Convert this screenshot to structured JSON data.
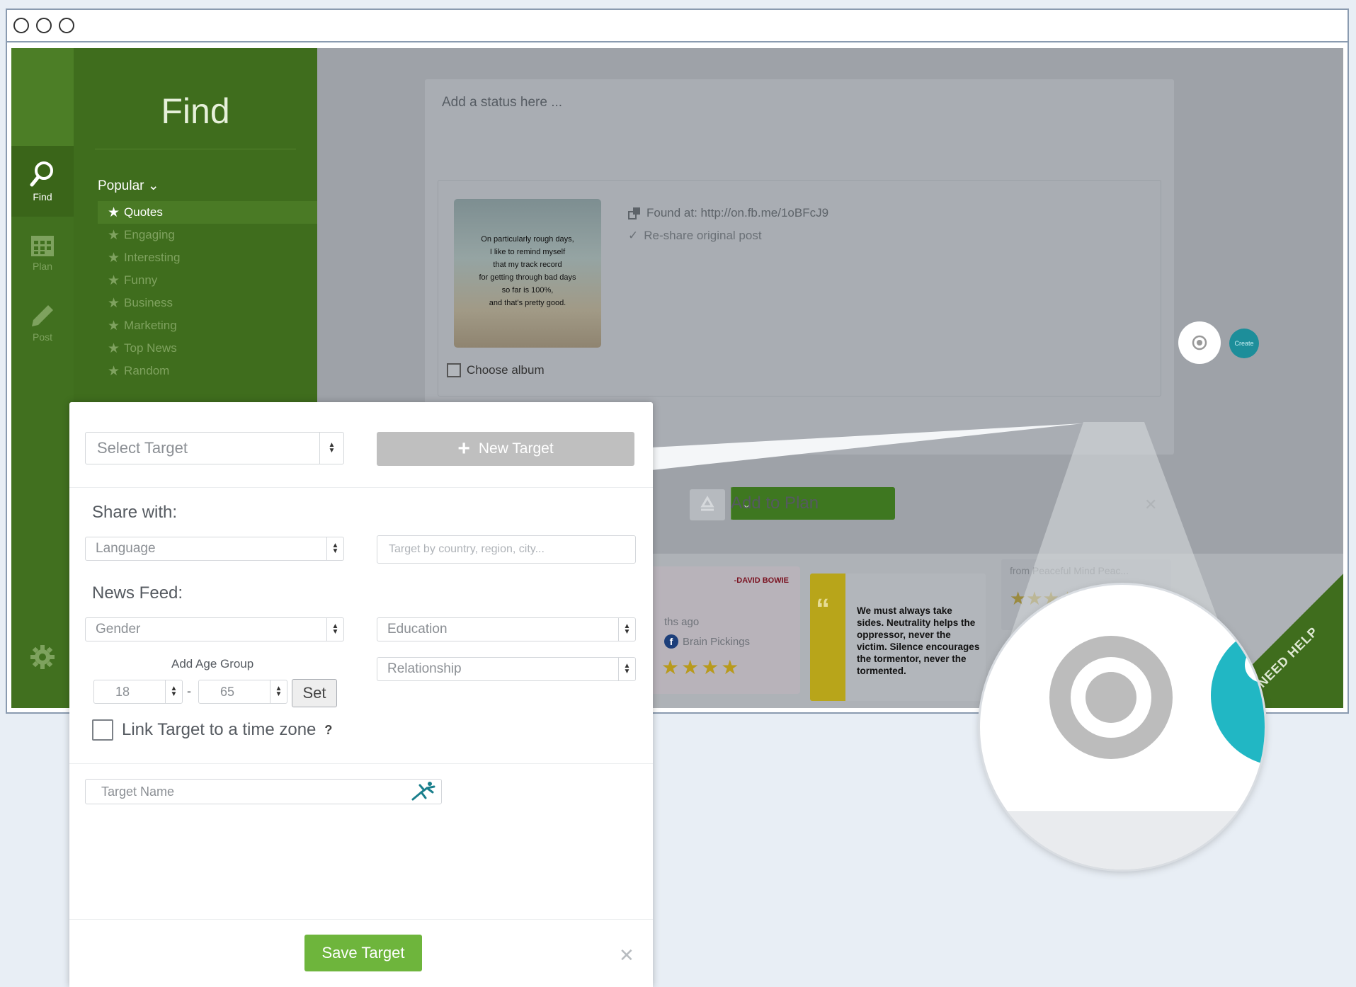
{
  "sidebar": {
    "nav": [
      {
        "label": "Find",
        "icon": "search-icon",
        "active": true
      },
      {
        "label": "Plan",
        "icon": "calendar-icon",
        "active": false
      },
      {
        "label": "Post",
        "icon": "pencil-icon",
        "active": false
      }
    ],
    "settings_icon": "gear-icon"
  },
  "find_panel": {
    "title": "Find",
    "popular_label": "Popular",
    "categories": [
      {
        "label": "Quotes",
        "active": true
      },
      {
        "label": "Engaging",
        "active": false
      },
      {
        "label": "Interesting",
        "active": false
      },
      {
        "label": "Funny",
        "active": false
      },
      {
        "label": "Business",
        "active": false
      },
      {
        "label": "Marketing",
        "active": false
      },
      {
        "label": "Top News",
        "active": false
      },
      {
        "label": "Random",
        "active": false
      }
    ]
  },
  "composer": {
    "status_placeholder": "Add a status here ...",
    "thumbnail_text": [
      "On particularly rough days,",
      "I like to remind myself",
      "that my track record",
      "for getting through bad days",
      "so far is 100%,",
      "and that's pretty good."
    ],
    "found_at": "Found at: http://on.fb.me/1oBFcJ9",
    "reshare": "Re-share original post",
    "choose_album": "Choose album",
    "teal_button_label": "Create",
    "add_to_plan": "Add to Plan"
  },
  "feed": {
    "card1": {
      "byline": "-DAVID BOWIE",
      "ago": "ths ago",
      "source": "Brain Pickings",
      "stars": "★★★★"
    },
    "card2": {
      "quote": "We must always take sides. Neutrality helps the oppressor, never the victim. Silence encourages the tormentor, never the tormented."
    },
    "card3": {
      "from": "from",
      "source": "Peaceful Mind Peac...",
      "stars": "★★★★"
    },
    "need_help": "NEED HELP"
  },
  "target_dialog": {
    "select_target": "Select Target",
    "new_target": "New Target",
    "share_with_label": "Share with:",
    "language": "Language",
    "location_placeholder": "Target by country, region, city...",
    "news_feed_label": "News Feed:",
    "gender": "Gender",
    "education": "Education",
    "relationship": "Relationship",
    "age_group_label": "Add Age Group",
    "age_min": "18",
    "age_separator": "-",
    "age_max": "65",
    "set_label": "Set",
    "timezone_label": "Link Target to a time zone",
    "help_mark": "?",
    "target_name_placeholder": "Target Name",
    "save_label": "Save Target"
  },
  "colors": {
    "brand_green": "#41701f",
    "save_green": "#6eb53c",
    "teal": "#21b7c4",
    "target_gray": "#bcbcbc"
  }
}
